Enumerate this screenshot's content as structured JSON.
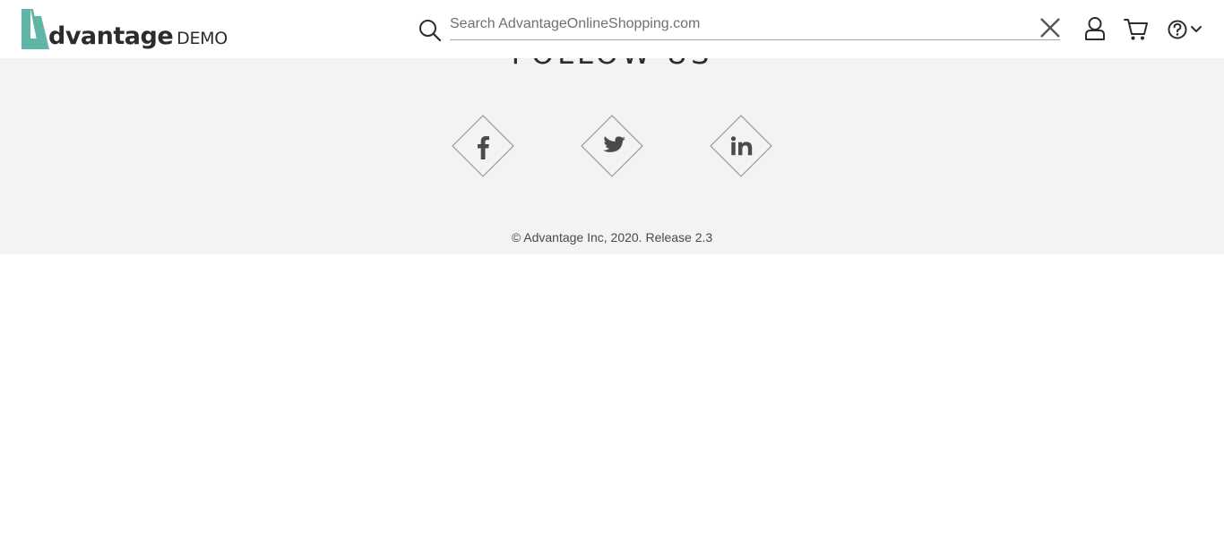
{
  "header": {
    "logo": {
      "word": "dvantage",
      "suffix": "DEMO",
      "accent_color": "#5fb5a6"
    },
    "search": {
      "placeholder": "Search AdvantageOnlineShopping.com",
      "value": ""
    },
    "icons": [
      "search-icon",
      "close-icon",
      "user-icon",
      "cart-icon",
      "help-icon",
      "chevron-down-icon"
    ]
  },
  "footer": {
    "follow_title": "FOLLOW US",
    "social": [
      {
        "name": "facebook",
        "icon": "facebook-icon"
      },
      {
        "name": "twitter",
        "icon": "twitter-icon"
      },
      {
        "name": "linkedin",
        "icon": "linkedin-icon"
      }
    ],
    "copyright": "© Advantage Inc, 2020. Release 2.3",
    "background_color": "#f3f3f1"
  }
}
